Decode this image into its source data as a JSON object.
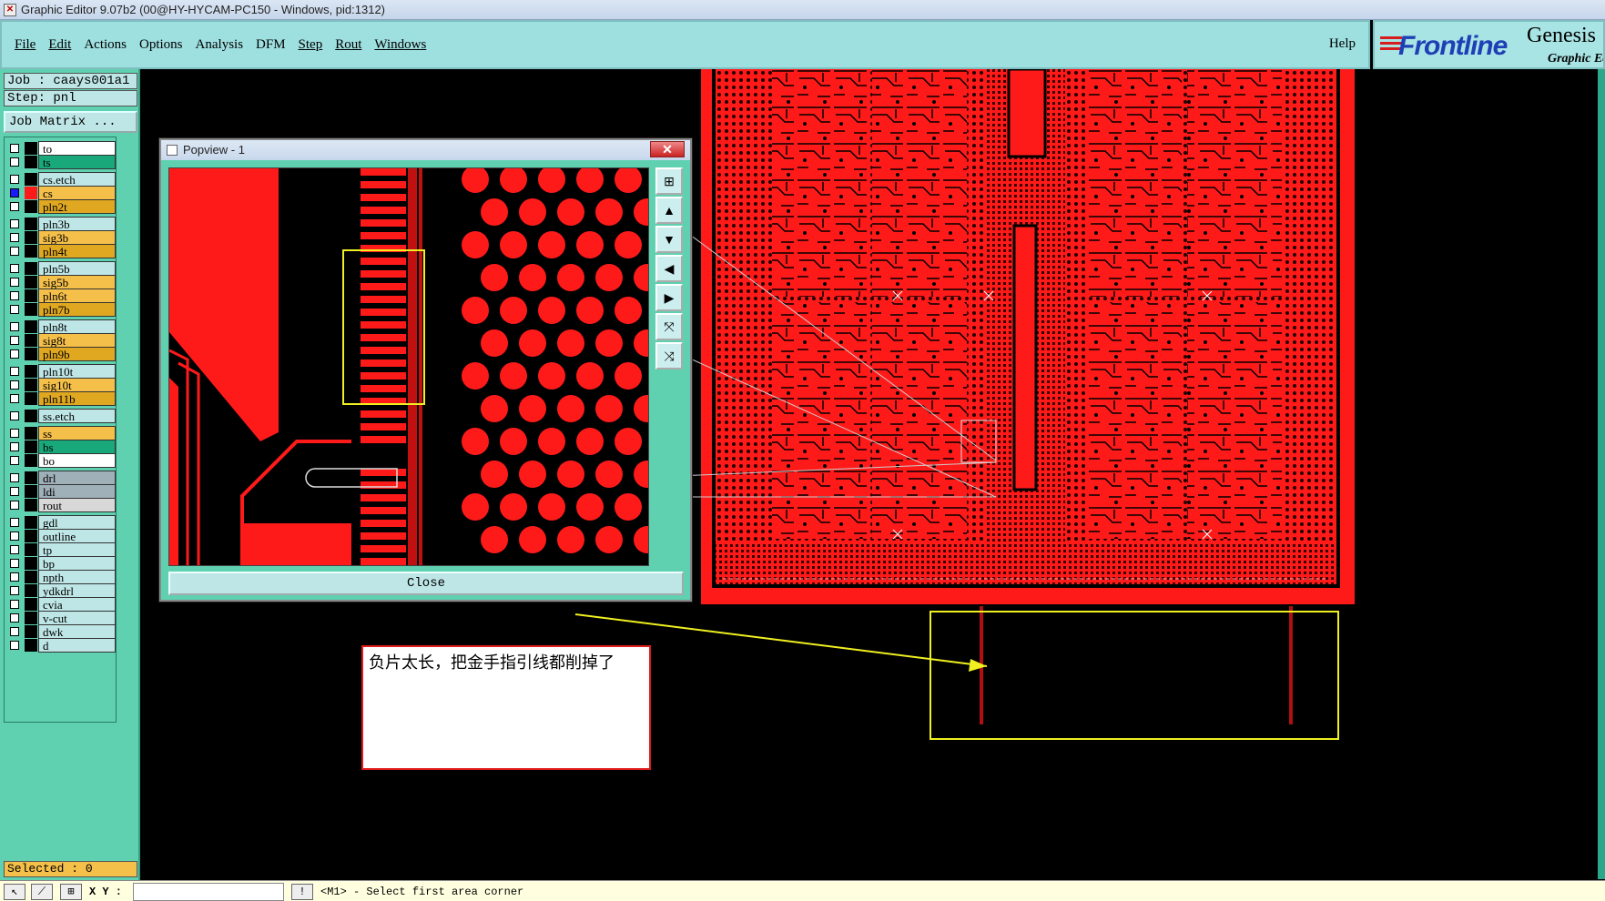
{
  "window": {
    "title": "Graphic Editor 9.07b2 (00@HY-HYCAM-PC150 - Windows, pid:1312)"
  },
  "menu": {
    "items": [
      "File",
      "Edit",
      "Actions",
      "Options",
      "Analysis",
      "DFM",
      "Step",
      "Rout",
      "Windows"
    ],
    "help": "Help"
  },
  "logo": {
    "brand": "Frontline",
    "product": "Genesis",
    "subtitle": "Graphic Ed"
  },
  "job": {
    "label": "Job : caays001a1",
    "step": "Step: pnl",
    "matrix_button": "Job Matrix ..."
  },
  "layers": [
    {
      "name": "to",
      "color": "#ffffff",
      "checked": false
    },
    {
      "name": "ts",
      "color": "#19a87a",
      "checked": false
    },
    {
      "name": "cs.etch",
      "color": "#bfe6e6",
      "checked": false
    },
    {
      "name": "cs",
      "color": "#f5c04a",
      "checked": true
    },
    {
      "name": "pln2t",
      "color": "#e0a820",
      "checked": false
    },
    {
      "name": "pln3b",
      "color": "#bfe6e6",
      "checked": false
    },
    {
      "name": "sig3b",
      "color": "#f5c04a",
      "checked": false
    },
    {
      "name": "pln4t",
      "color": "#e0a820",
      "checked": false
    },
    {
      "name": "pln5b",
      "color": "#bfe6e6",
      "checked": false
    },
    {
      "name": "sig5b",
      "color": "#f5c04a",
      "checked": false
    },
    {
      "name": "pln6t",
      "color": "#f5c04a",
      "checked": false
    },
    {
      "name": "pln7b",
      "color": "#e0a820",
      "checked": false
    },
    {
      "name": "pln8t",
      "color": "#bfe6e6",
      "checked": false
    },
    {
      "name": "sig8t",
      "color": "#f5c04a",
      "checked": false
    },
    {
      "name": "pln9b",
      "color": "#e0a820",
      "checked": false
    },
    {
      "name": "pln10t",
      "color": "#bfe6e6",
      "checked": false
    },
    {
      "name": "sig10t",
      "color": "#f5c04a",
      "checked": false
    },
    {
      "name": "pln11b",
      "color": "#e0a820",
      "checked": false
    },
    {
      "name": "ss.etch",
      "color": "#bfe6e6",
      "checked": false
    },
    {
      "name": "ss",
      "color": "#f5c04a",
      "checked": false
    },
    {
      "name": "bs",
      "color": "#19a87a",
      "checked": false
    },
    {
      "name": "bo",
      "color": "#ffffff",
      "checked": false
    },
    {
      "name": "drl",
      "color": "#a0b0b8",
      "checked": false
    },
    {
      "name": "ldi",
      "color": "#a0b0b8",
      "checked": false
    },
    {
      "name": "rout",
      "color": "#d8d8d8",
      "checked": false
    },
    {
      "name": "gdl",
      "color": "#bfe6e6",
      "checked": false
    },
    {
      "name": "outline",
      "color": "#bfe6e6",
      "checked": false
    },
    {
      "name": "tp",
      "color": "#bfe6e6",
      "checked": false
    },
    {
      "name": "bp",
      "color": "#bfe6e6",
      "checked": false
    },
    {
      "name": "npth",
      "color": "#bfe6e6",
      "checked": false
    },
    {
      "name": "ydkdrl",
      "color": "#bfe6e6",
      "checked": false
    },
    {
      "name": "cvia",
      "color": "#bfe6e6",
      "checked": false
    },
    {
      "name": "v-cut",
      "color": "#bfe6e6",
      "checked": false
    },
    {
      "name": "dwk",
      "color": "#bfe6e6",
      "checked": false
    },
    {
      "name": "d",
      "color": "#bfe6e6",
      "checked": false
    }
  ],
  "selected": "Selected : 0",
  "status": {
    "xy_label": "X Y :",
    "xy_value": "",
    "message": "<M1> - Select first area corner"
  },
  "popview": {
    "title": "Popview - 1",
    "close_label": "Close"
  },
  "annotation": {
    "text": "负片太长，把金手指引线都削掉了"
  },
  "colors": {
    "copper": "#ff1a1a",
    "background": "#000000",
    "highlight": "#f0f020",
    "panel": "#5fd1b0",
    "menu": "#9edfe0"
  }
}
